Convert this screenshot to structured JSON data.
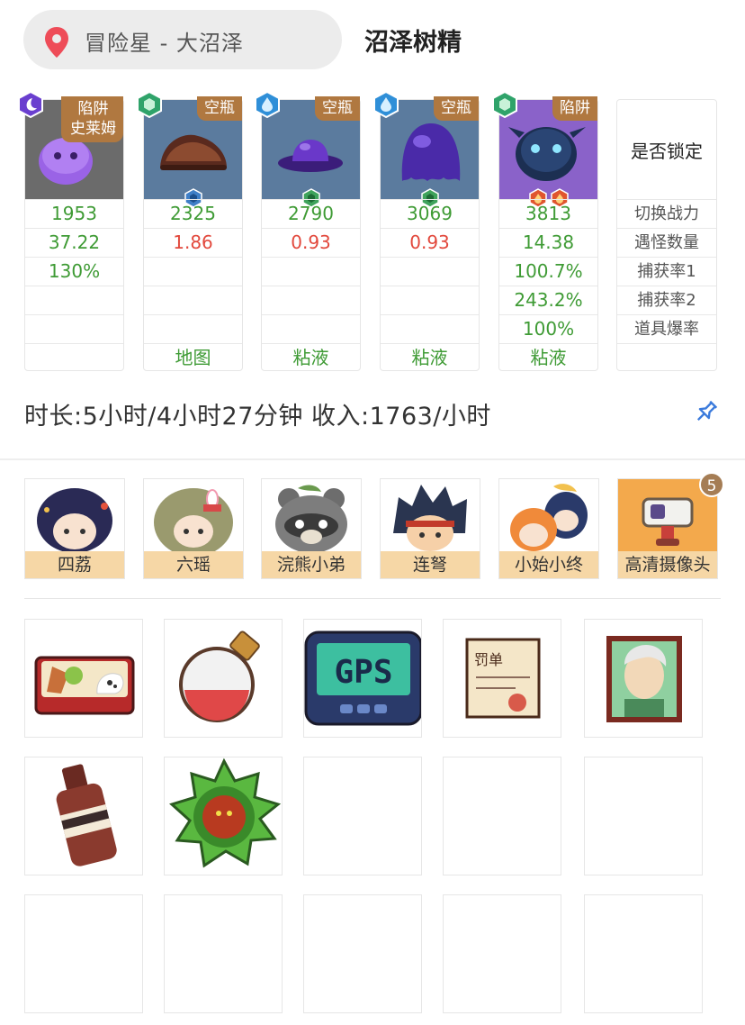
{
  "header": {
    "location": "冒险星 - 大沼泽",
    "boss": "沼泽树精"
  },
  "monsters": [
    {
      "tag": [
        "陷阱",
        "史莱姆"
      ],
      "power": "1953",
      "count": "37.22",
      "catch1": "130%",
      "catch2": "",
      "drop": "",
      "item": "",
      "count_color": "green"
    },
    {
      "tag": [
        "空瓶"
      ],
      "power": "2325",
      "count": "1.86",
      "catch1": "",
      "catch2": "",
      "drop": "",
      "item": "地图",
      "count_color": "red"
    },
    {
      "tag": [
        "空瓶"
      ],
      "power": "2790",
      "count": "0.93",
      "catch1": "",
      "catch2": "",
      "drop": "",
      "item": "粘液",
      "count_color": "red"
    },
    {
      "tag": [
        "空瓶"
      ],
      "power": "3069",
      "count": "0.93",
      "catch1": "",
      "catch2": "",
      "drop": "",
      "item": "粘液",
      "count_color": "red"
    },
    {
      "tag": [
        "陷阱"
      ],
      "power": "3813",
      "count": "14.38",
      "catch1": "100.7%",
      "catch2": "243.2%",
      "drop": "100%",
      "item": "粘液",
      "count_color": "green"
    }
  ],
  "labels": {
    "lock": "是否锁定",
    "power": "切换战力",
    "count": "遇怪数量",
    "catch1": "捕获率1",
    "catch2": "捕获率2",
    "drop": "道具爆率"
  },
  "summary": {
    "duration_text": "时长:5小时/4小时27分钟 收入:1763/小时"
  },
  "team": [
    {
      "name": "四荔"
    },
    {
      "name": "六瑶"
    },
    {
      "name": "浣熊小弟"
    },
    {
      "name": "连弩"
    },
    {
      "name": "小始小终"
    },
    {
      "name": "高清摄像头",
      "badge": "5"
    }
  ],
  "items": {
    "gps_label": "GPS",
    "ticket_label": "罚单",
    "slots": [
      "bento-icon",
      "potion-flask-icon",
      "gps-device-icon",
      "fine-ticket-icon",
      "portrait-card-icon",
      "brown-bottle-icon",
      "green-medal-icon",
      "",
      "",
      "",
      "",
      "",
      "",
      "",
      ""
    ]
  },
  "colors": {
    "value_green": "#3f9b35",
    "value_red": "#e2483c",
    "tag_brown": "#b07840",
    "name_bar": "#f6d7a6",
    "pin_blue": "#3b7bdc",
    "location_red": "#ee4c58"
  }
}
